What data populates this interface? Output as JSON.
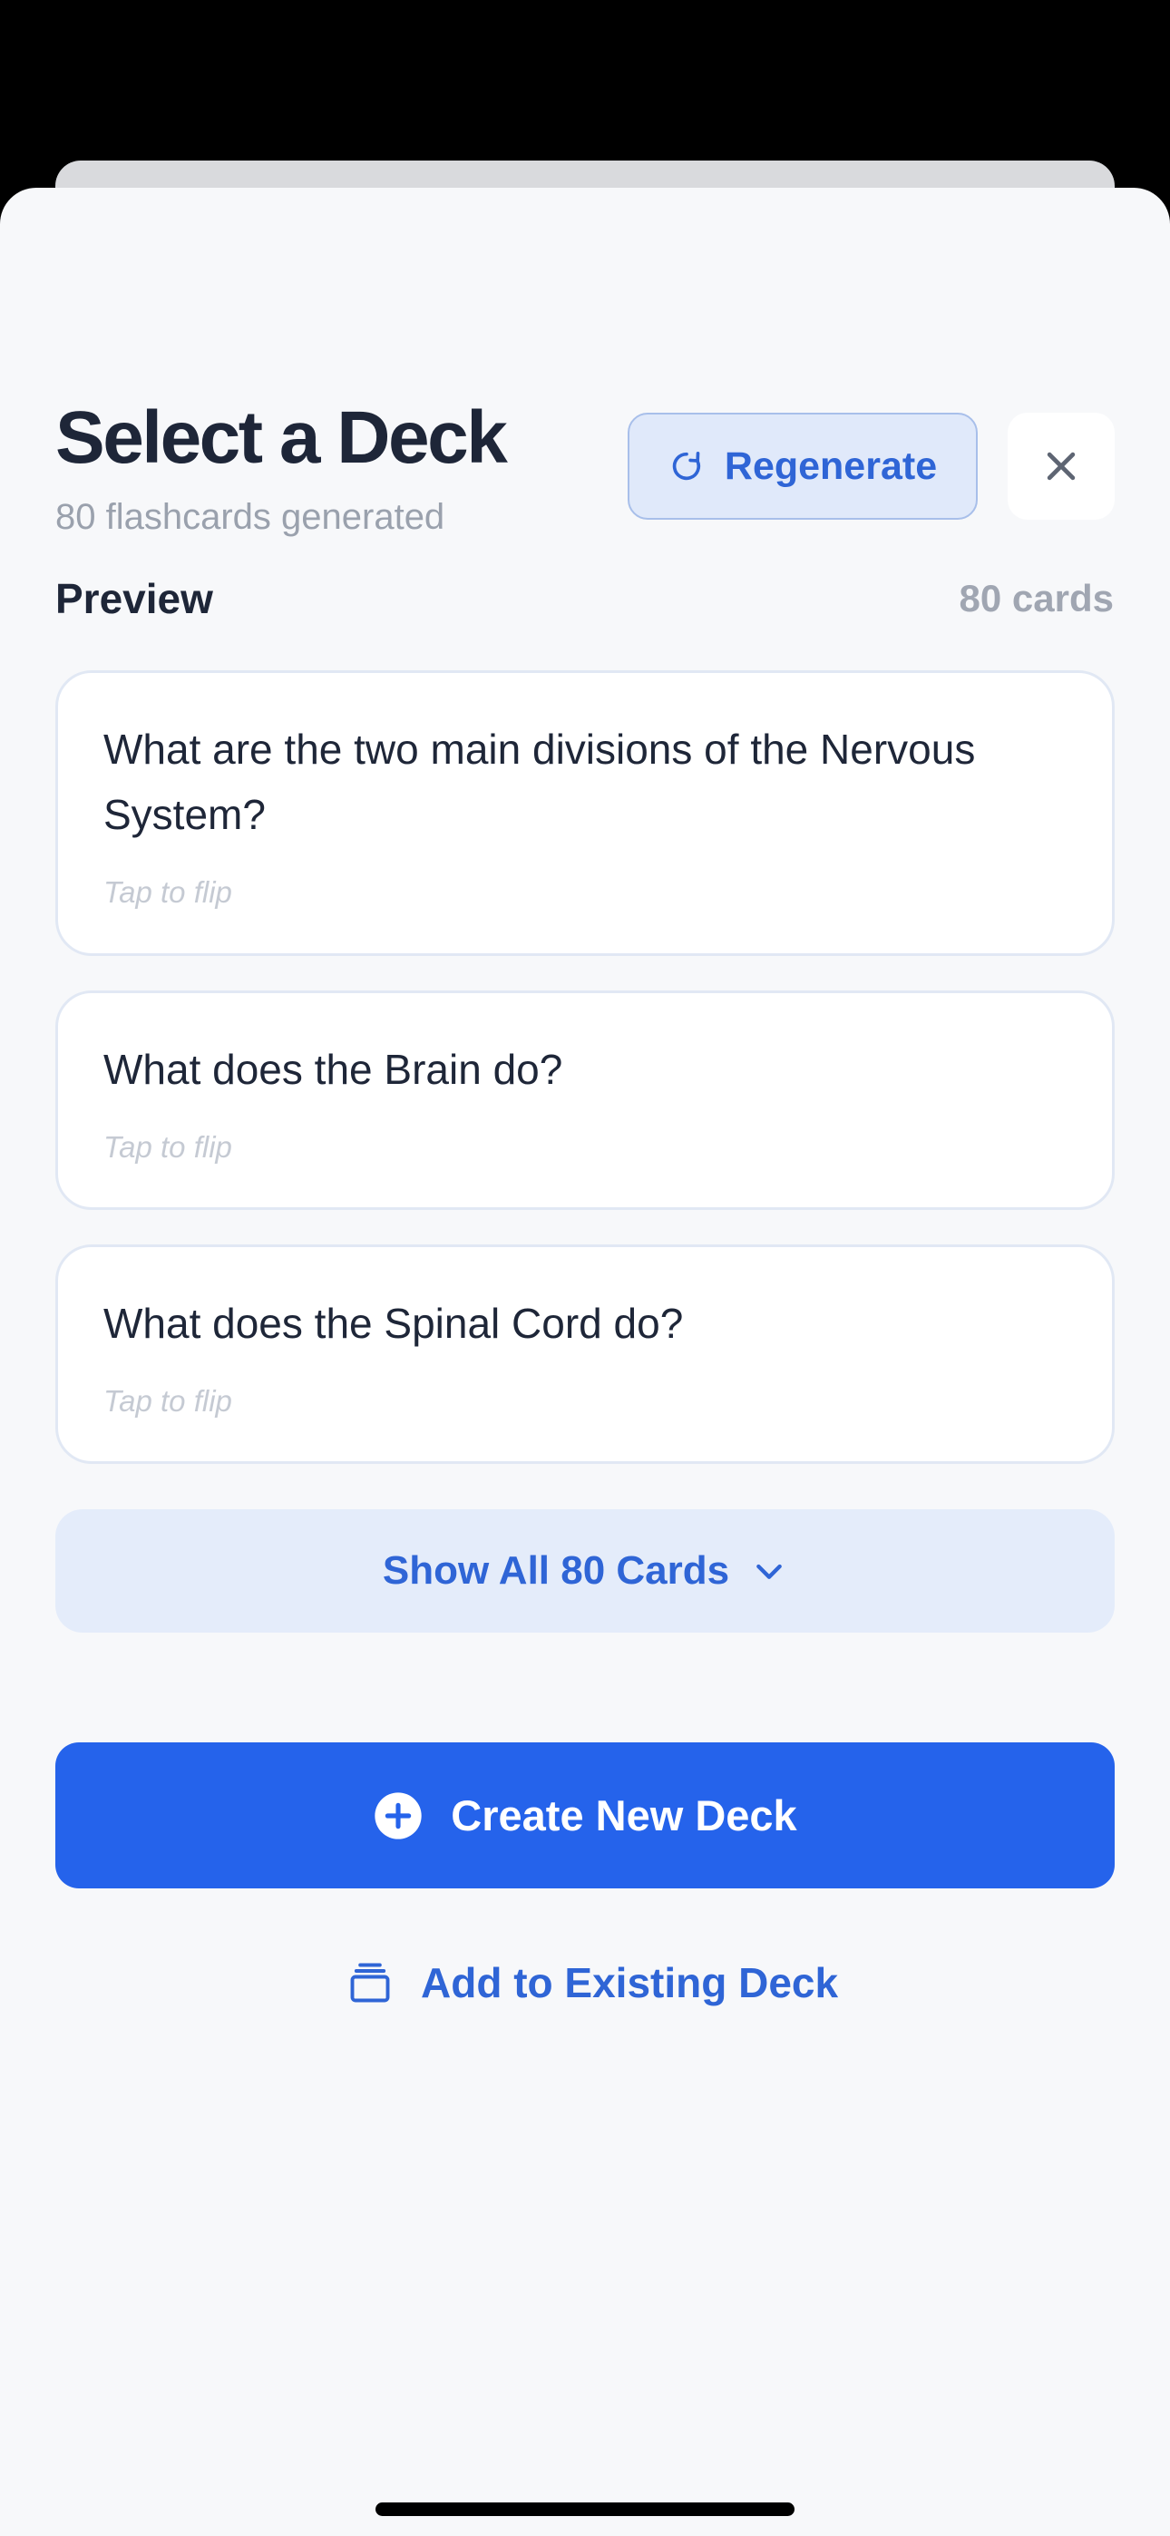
{
  "header": {
    "title": "Select a Deck",
    "subtitle": "80 flashcards generated",
    "regenerate_label": "Regenerate"
  },
  "preview": {
    "label": "Preview",
    "count": "80 cards",
    "cards": [
      {
        "question": "What are the two main divisions of the Nervous System?",
        "hint": "Tap to flip"
      },
      {
        "question": "What does the Brain do?",
        "hint": "Tap to flip"
      },
      {
        "question": "What does the Spinal Cord do?",
        "hint": "Tap to flip"
      }
    ],
    "show_all_label": "Show All 80 Cards"
  },
  "actions": {
    "create_label": "Create New Deck",
    "add_existing_label": "Add to Existing Deck"
  },
  "icons": {
    "regenerate": "refresh-icon",
    "close": "close-icon",
    "show_all": "chevron-down-icon",
    "create": "plus-circle-icon",
    "add_existing": "stack-icon"
  },
  "colors": {
    "accent": "#2563EB",
    "accent_text": "#2F65D6",
    "heading": "#1E2638",
    "muted": "#9AA1AD",
    "sheet_bg": "#F7F8FA"
  }
}
